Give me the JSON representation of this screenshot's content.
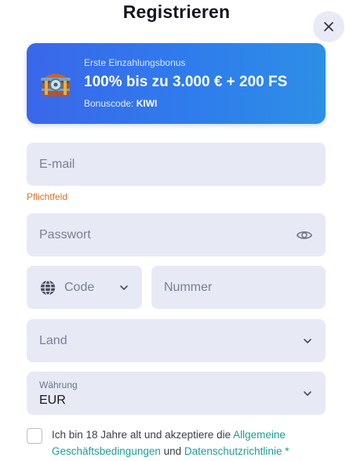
{
  "header": {
    "title": "Registrieren"
  },
  "bonus": {
    "subtitle": "Erste Einzahlungsbonus",
    "headline": "100% bis zu 3.000 € + 200 FS",
    "code_label": "Bonuscode:",
    "code_value": "KIWI"
  },
  "form": {
    "email_placeholder": "E-mail",
    "email_hint": "Pflichtfeld",
    "password_placeholder": "Passwort",
    "code_placeholder": "Code",
    "number_placeholder": "Nummer",
    "country_placeholder": "Land",
    "currency_label": "Währung",
    "currency_value": "EUR"
  },
  "agreement": {
    "text_before": "Ich bin 18 Jahre alt und akzeptiere die ",
    "link_terms": "Allgemeine Geschäftsbedingungen",
    "text_middle": " und ",
    "link_privacy": "Datenschutzrichtlinie",
    "required_mark": " *"
  },
  "icons": {
    "close": "close-icon",
    "chest": "treasure-chest-icon",
    "eye": "eye-icon",
    "globe": "globe-icon",
    "chevron": "chevron-down-icon"
  },
  "colors": {
    "accent_link": "#1a9e9a",
    "hint": "#e2711d",
    "field_bg": "#e7eaf5",
    "bonus_gradient_start": "#3a67ea",
    "bonus_gradient_end": "#2d8fe6"
  }
}
